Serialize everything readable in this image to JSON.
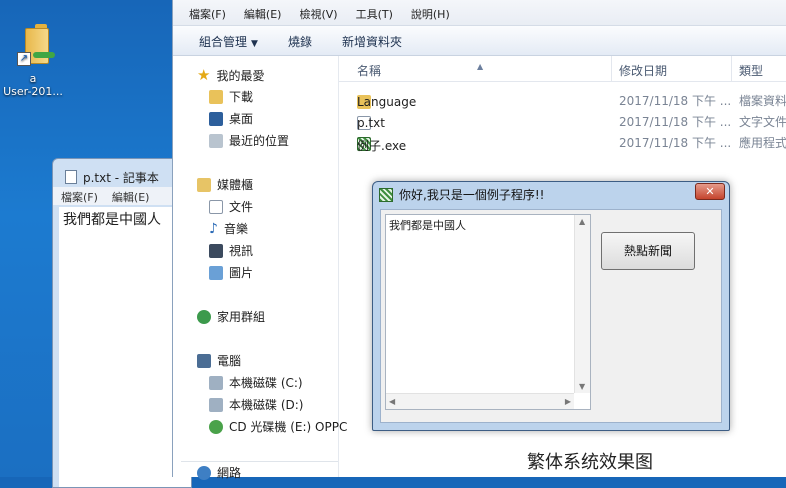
{
  "desktop": {
    "icon_label_1": "a",
    "icon_label_2": "User-201..."
  },
  "notepad": {
    "title": "p.txt - 記事本",
    "menu": [
      "檔案(F)",
      "編輯(E)"
    ],
    "content": "我們都是中國人"
  },
  "explorer": {
    "menu": [
      "檔案(F)",
      "編輯(E)",
      "檢視(V)",
      "工具(T)",
      "說明(H)"
    ],
    "toolbar": {
      "organize": "組合管理",
      "burn": "燒錄",
      "new_folder": "新增資料夾"
    },
    "nav": {
      "favorites": "我的最愛",
      "downloads": "下載",
      "desktop": "桌面",
      "recent": "最近的位置",
      "libraries": "媒體櫃",
      "documents": "文件",
      "music": "音樂",
      "videos": "視訊",
      "pictures": "圖片",
      "homegroup": "家用群組",
      "computer": "電腦",
      "drive_c": "本機磁碟 (C:)",
      "drive_d": "本機磁碟 (D:)",
      "drive_e": "CD 光碟機 (E:) OPPC",
      "network": "網路"
    },
    "columns": {
      "name": "名稱",
      "date": "修改日期",
      "type": "類型"
    },
    "files": [
      {
        "name": "Language",
        "date": "2017/11/18 下午 ...",
        "type": "檔案資料..."
      },
      {
        "name": "p.txt",
        "date": "2017/11/18 下午 ...",
        "type": "文字文件"
      },
      {
        "name": "例子.exe",
        "date": "2017/11/18 下午 ...",
        "type": "應用程式"
      }
    ],
    "caption": "繁体系统效果图"
  },
  "dialog": {
    "title": "你好,我只是一個例子程序!!",
    "close": "✕",
    "textbox_content": "我們都是中國人",
    "button": "熱點新聞"
  }
}
